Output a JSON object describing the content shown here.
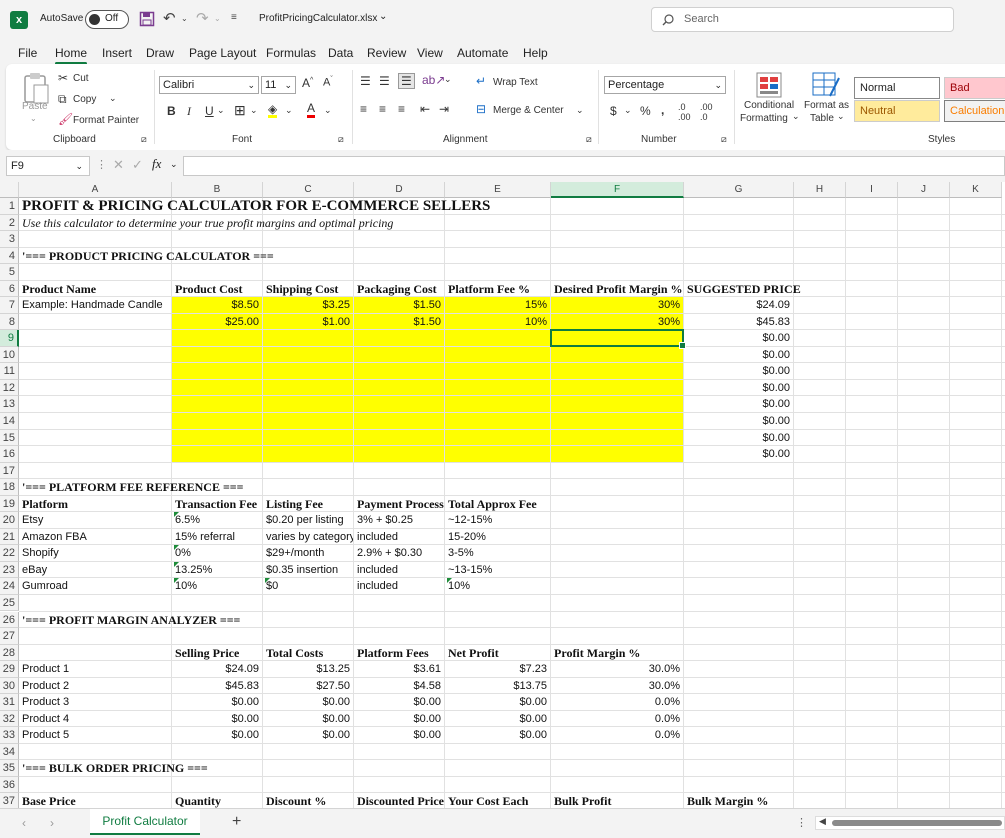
{
  "title_bar": {
    "autosave_label": "AutoSave",
    "autosave_state": "Off",
    "filename": "ProfitPricingCalculator.xlsx",
    "search_placeholder": "Search"
  },
  "menu": [
    "File",
    "Home",
    "Insert",
    "Draw",
    "Page Layout",
    "Formulas",
    "Data",
    "Review",
    "View",
    "Automate",
    "Help"
  ],
  "ribbon": {
    "clipboard": {
      "paste": "Paste",
      "cut": "Cut",
      "copy": "Copy",
      "format_painter": "Format Painter",
      "group": "Clipboard"
    },
    "font": {
      "name": "Calibri",
      "size": "11",
      "group": "Font"
    },
    "alignment": {
      "wrap": "Wrap Text",
      "merge": "Merge & Center",
      "group": "Alignment"
    },
    "number": {
      "format": "Percentage",
      "group": "Number"
    },
    "styles": {
      "conditional_1": "Conditional",
      "conditional_2": "Formatting",
      "format_table_1": "Format as",
      "format_table_2": "Table",
      "normal": "Normal",
      "bad": "Bad",
      "neutral": "Neutral",
      "calculation": "Calculation",
      "group": "Styles"
    }
  },
  "formula_bar": {
    "cell_ref": "F9",
    "fx": "fx",
    "value": ""
  },
  "columns": [
    "A",
    "B",
    "C",
    "D",
    "E",
    "F",
    "G",
    "H",
    "I",
    "J",
    "K"
  ],
  "selected_cell": "F9",
  "cells": [
    {
      "ref": "A1",
      "v": "PROFIT & PRICING CALCULATOR FOR E-COMMERCE SELLERS",
      "s": "h1"
    },
    {
      "ref": "A2",
      "v": "Use this calculator to determine your true profit margins and optimal pricing",
      "s": "i"
    },
    {
      "ref": "A4",
      "v": "'=== PRODUCT PRICING CALCULATOR ===",
      "s": "b"
    },
    {
      "ref": "A6",
      "v": "Product Name",
      "s": "b"
    },
    {
      "ref": "B6",
      "v": "Product Cost",
      "s": "b"
    },
    {
      "ref": "C6",
      "v": "Shipping Cost",
      "s": "b"
    },
    {
      "ref": "D6",
      "v": "Packaging Cost",
      "s": "b"
    },
    {
      "ref": "E6",
      "v": "Platform Fee %",
      "s": "b"
    },
    {
      "ref": "F6",
      "v": "Desired Profit Margin %",
      "s": "b clip"
    },
    {
      "ref": "G6",
      "v": "SUGGESTED PRICE",
      "s": "b"
    },
    {
      "ref": "A7",
      "v": "Example: Handmade Candle"
    },
    {
      "ref": "B7",
      "v": "$8.50",
      "s": "r"
    },
    {
      "ref": "C7",
      "v": "$3.25",
      "s": "r"
    },
    {
      "ref": "D7",
      "v": "$1.50",
      "s": "r"
    },
    {
      "ref": "E7",
      "v": "15%",
      "s": "r"
    },
    {
      "ref": "F7",
      "v": "30%",
      "s": "r"
    },
    {
      "ref": "G7",
      "v": "$24.09",
      "s": "r"
    },
    {
      "ref": "B8",
      "v": "$25.00",
      "s": "r"
    },
    {
      "ref": "C8",
      "v": "$1.00",
      "s": "r"
    },
    {
      "ref": "D8",
      "v": "$1.50",
      "s": "r"
    },
    {
      "ref": "E8",
      "v": "10%",
      "s": "r"
    },
    {
      "ref": "F8",
      "v": "30%",
      "s": "r"
    },
    {
      "ref": "G8",
      "v": "$45.83",
      "s": "r"
    },
    {
      "ref": "G9",
      "v": "$0.00",
      "s": "r"
    },
    {
      "ref": "G10",
      "v": "$0.00",
      "s": "r"
    },
    {
      "ref": "G11",
      "v": "$0.00",
      "s": "r"
    },
    {
      "ref": "G12",
      "v": "$0.00",
      "s": "r"
    },
    {
      "ref": "G13",
      "v": "$0.00",
      "s": "r"
    },
    {
      "ref": "G14",
      "v": "$0.00",
      "s": "r"
    },
    {
      "ref": "G15",
      "v": "$0.00",
      "s": "r"
    },
    {
      "ref": "G16",
      "v": "$0.00",
      "s": "r"
    },
    {
      "ref": "A18",
      "v": "'=== PLATFORM FEE REFERENCE ===",
      "s": "b"
    },
    {
      "ref": "A19",
      "v": "Platform",
      "s": "b"
    },
    {
      "ref": "B19",
      "v": "Transaction Fee",
      "s": "b clip"
    },
    {
      "ref": "C19",
      "v": "Listing Fee",
      "s": "b"
    },
    {
      "ref": "D19",
      "v": "Payment Processing",
      "s": "b clip"
    },
    {
      "ref": "E19",
      "v": "Total Approx Fee",
      "s": "b"
    },
    {
      "ref": "A20",
      "v": "Etsy"
    },
    {
      "ref": "B20",
      "v": "6.5%",
      "s": "tri"
    },
    {
      "ref": "C20",
      "v": "$0.20 per listing"
    },
    {
      "ref": "D20",
      "v": "3% + $0.25"
    },
    {
      "ref": "E20",
      "v": "~12-15%"
    },
    {
      "ref": "A21",
      "v": "Amazon FBA"
    },
    {
      "ref": "B21",
      "v": "15% referral"
    },
    {
      "ref": "C21",
      "v": "varies by category",
      "s": "clip"
    },
    {
      "ref": "D21",
      "v": "included"
    },
    {
      "ref": "E21",
      "v": "15-20%"
    },
    {
      "ref": "A22",
      "v": "Shopify"
    },
    {
      "ref": "B22",
      "v": "0%",
      "s": "tri"
    },
    {
      "ref": "C22",
      "v": "$29+/month"
    },
    {
      "ref": "D22",
      "v": "2.9% + $0.30"
    },
    {
      "ref": "E22",
      "v": "3-5%"
    },
    {
      "ref": "A23",
      "v": "eBay"
    },
    {
      "ref": "B23",
      "v": "13.25%",
      "s": "tri"
    },
    {
      "ref": "C23",
      "v": "$0.35 insertion"
    },
    {
      "ref": "D23",
      "v": "included"
    },
    {
      "ref": "E23",
      "v": "~13-15%"
    },
    {
      "ref": "A24",
      "v": "Gumroad"
    },
    {
      "ref": "B24",
      "v": "10%",
      "s": "tri"
    },
    {
      "ref": "C24",
      "v": "$0",
      "s": "tri"
    },
    {
      "ref": "D24",
      "v": "included"
    },
    {
      "ref": "E24",
      "v": "10%",
      "s": "tri"
    },
    {
      "ref": "A26",
      "v": "'=== PROFIT MARGIN ANALYZER ===",
      "s": "b"
    },
    {
      "ref": "B28",
      "v": "Selling Price",
      "s": "b"
    },
    {
      "ref": "C28",
      "v": "Total Costs",
      "s": "b"
    },
    {
      "ref": "D28",
      "v": "Platform Fees",
      "s": "b"
    },
    {
      "ref": "E28",
      "v": "Net Profit",
      "s": "b"
    },
    {
      "ref": "F28",
      "v": "Profit Margin %",
      "s": "b"
    },
    {
      "ref": "A29",
      "v": "Product 1"
    },
    {
      "ref": "B29",
      "v": "$24.09",
      "s": "r"
    },
    {
      "ref": "C29",
      "v": "$13.25",
      "s": "r"
    },
    {
      "ref": "D29",
      "v": "$3.61",
      "s": "r"
    },
    {
      "ref": "E29",
      "v": "$7.23",
      "s": "r"
    },
    {
      "ref": "F29",
      "v": "30.0%",
      "s": "r"
    },
    {
      "ref": "A30",
      "v": "Product 2"
    },
    {
      "ref": "B30",
      "v": "$45.83",
      "s": "r"
    },
    {
      "ref": "C30",
      "v": "$27.50",
      "s": "r"
    },
    {
      "ref": "D30",
      "v": "$4.58",
      "s": "r"
    },
    {
      "ref": "E30",
      "v": "$13.75",
      "s": "r"
    },
    {
      "ref": "F30",
      "v": "30.0%",
      "s": "r"
    },
    {
      "ref": "A31",
      "v": "Product 3"
    },
    {
      "ref": "B31",
      "v": "$0.00",
      "s": "r"
    },
    {
      "ref": "C31",
      "v": "$0.00",
      "s": "r"
    },
    {
      "ref": "D31",
      "v": "$0.00",
      "s": "r"
    },
    {
      "ref": "E31",
      "v": "$0.00",
      "s": "r"
    },
    {
      "ref": "F31",
      "v": "0.0%",
      "s": "r"
    },
    {
      "ref": "A32",
      "v": "Product 4"
    },
    {
      "ref": "B32",
      "v": "$0.00",
      "s": "r"
    },
    {
      "ref": "C32",
      "v": "$0.00",
      "s": "r"
    },
    {
      "ref": "D32",
      "v": "$0.00",
      "s": "r"
    },
    {
      "ref": "E32",
      "v": "$0.00",
      "s": "r"
    },
    {
      "ref": "F32",
      "v": "0.0%",
      "s": "r"
    },
    {
      "ref": "A33",
      "v": "Product 5"
    },
    {
      "ref": "B33",
      "v": "$0.00",
      "s": "r"
    },
    {
      "ref": "C33",
      "v": "$0.00",
      "s": "r"
    },
    {
      "ref": "D33",
      "v": "$0.00",
      "s": "r"
    },
    {
      "ref": "E33",
      "v": "$0.00",
      "s": "r"
    },
    {
      "ref": "F33",
      "v": "0.0%",
      "s": "r"
    },
    {
      "ref": "A35",
      "v": "'=== BULK ORDER PRICING ===",
      "s": "b"
    },
    {
      "ref": "A37",
      "v": "Base Price",
      "s": "b"
    },
    {
      "ref": "B37",
      "v": "Quantity",
      "s": "b"
    },
    {
      "ref": "C37",
      "v": "Discount %",
      "s": "b"
    },
    {
      "ref": "D37",
      "v": "Discounted Price",
      "s": "b clip"
    },
    {
      "ref": "E37",
      "v": "Your Cost Each",
      "s": "b"
    },
    {
      "ref": "F37",
      "v": "Bulk Profit",
      "s": "b"
    },
    {
      "ref": "G37",
      "v": "Bulk Margin %",
      "s": "b"
    }
  ],
  "sheet_tab": "Profit Calculator",
  "colors": {
    "accent": "#107c41",
    "input_fill": "#ffff00",
    "bad_bg": "#ffc7ce",
    "bad_text": "#9c0006",
    "neutral_bg": "#ffeb9c",
    "neutral_text": "#9c5700",
    "calc_text": "#fa7d00"
  }
}
